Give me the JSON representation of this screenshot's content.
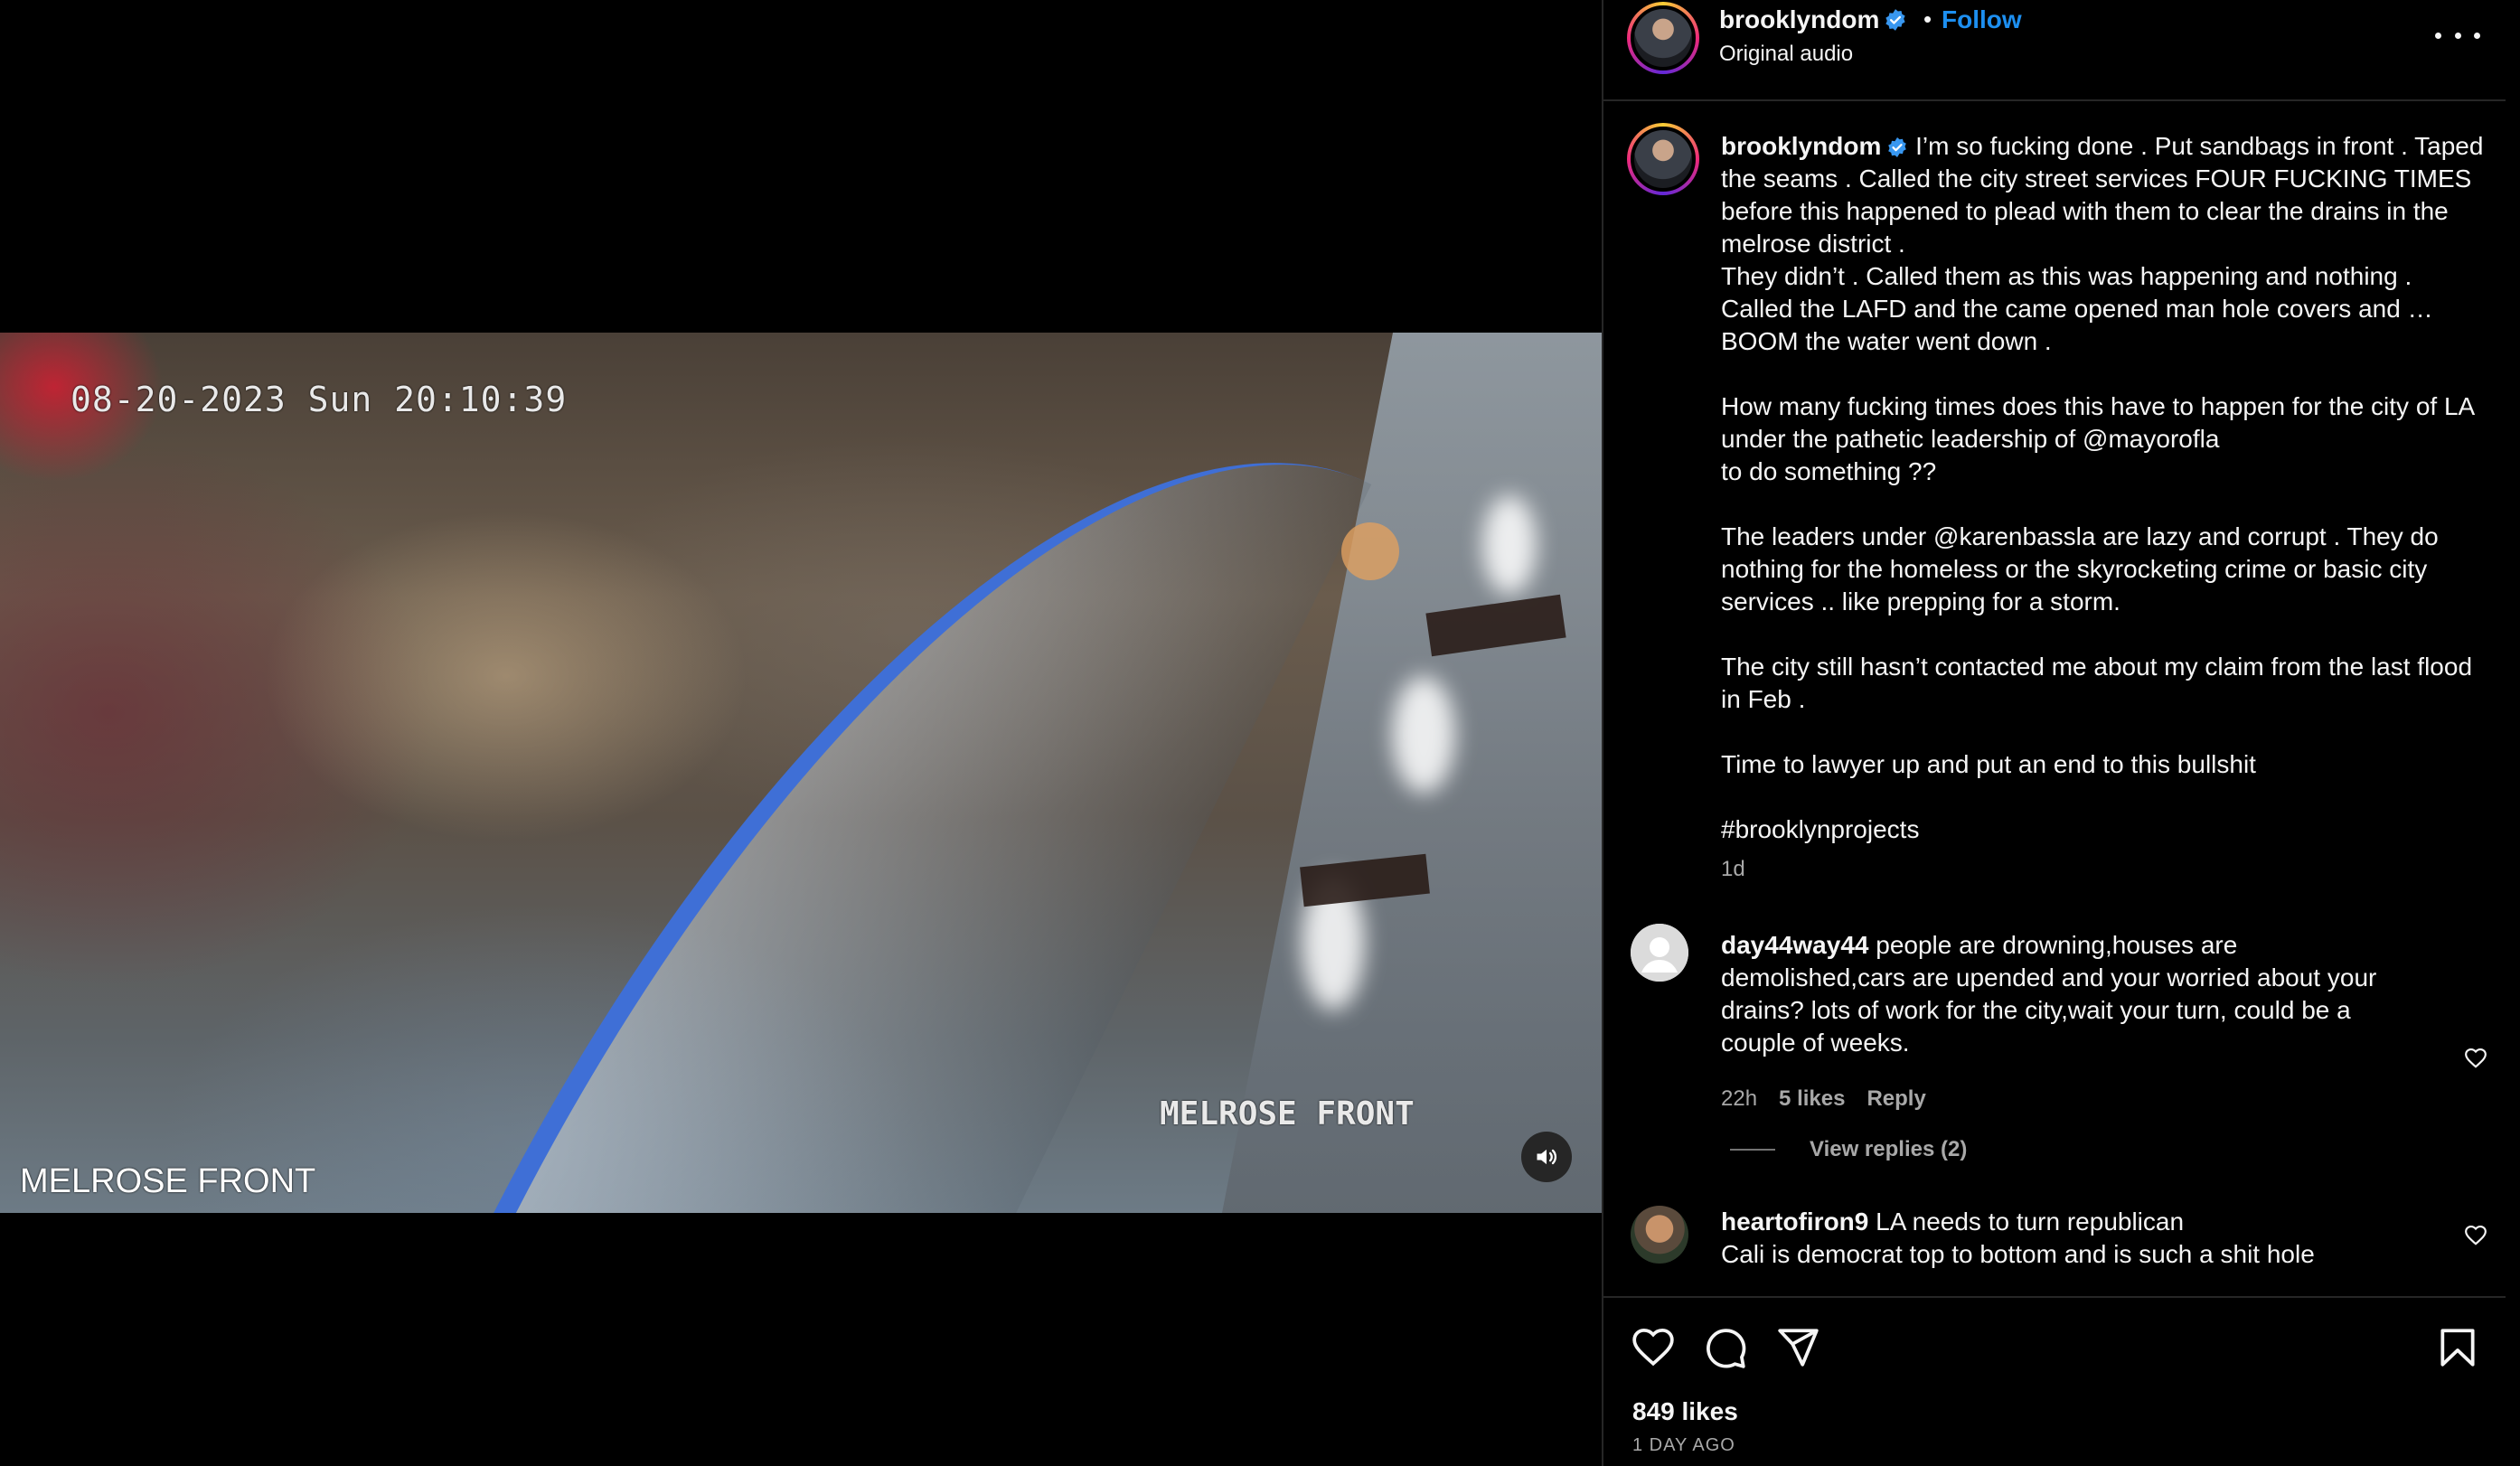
{
  "video": {
    "timestamp": "08-20-2023 Sun 20:10:39",
    "camera_label_right": "MELROSE FRONT",
    "camera_label_left": "MELROSE FRONT",
    "mute_icon": "speaker-icon"
  },
  "header": {
    "username": "brooklyndom",
    "dot": "•",
    "follow_label": "Follow",
    "audio": "Original audio"
  },
  "caption": {
    "username": "brooklyndom",
    "text": " I’m so fucking done . Put sandbags in front . Taped the seams . Called the city street services FOUR FUCKING TIMES before this happened to plead with them to clear the drains in the melrose district .\nThey didn’t . Called them as this was happening and nothing . Called the LAFD and the came opened man hole covers and … BOOM the water went down .\n\nHow many fucking times does this have to happen for the city of LA under the pathetic leadership of @mayorofla\nto do something ??\n\nThe leaders under @karenbassla are lazy and corrupt . They do nothing for the homeless or the skyrocketing crime or basic city services .. like prepping for a storm.\n\nThe city still hasn’t contacted me about my claim from the last flood in Feb .\n\nTime to lawyer up and put an end to this bullshit\n\n#brooklynprojects",
    "time": "1d"
  },
  "comments": [
    {
      "username": "day44way44",
      "text": " people are drowning,houses are demolished,cars are upended and your worried about your drains? lots of work for the city,wait your turn, could be a couple of weeks.",
      "time": "22h",
      "likes": "5 likes",
      "reply": "Reply"
    },
    {
      "username": "heartofiron9",
      "text": " LA needs to turn republican\nCali is democrat top to bottom and is such a shit hole"
    }
  ],
  "view_replies": "View replies (2)",
  "footer": {
    "likes": "849 likes",
    "age": "1 DAY AGO"
  },
  "colors": {
    "accent": "#1d8ff0",
    "verified": "#3897f0",
    "secondary_text": "#a8a8a8",
    "divider": "#262626"
  }
}
